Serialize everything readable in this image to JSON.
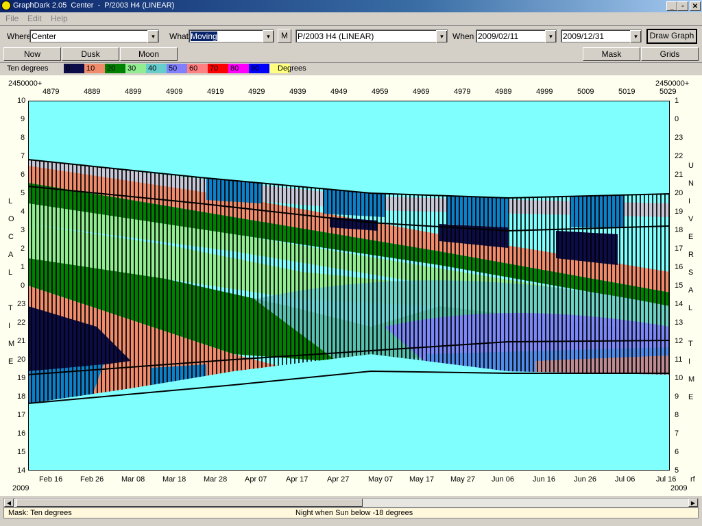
{
  "titlebar": {
    "title": "GraphDark 2.05  Center  -  P/2003 H4 (LINEAR)",
    "min": "_",
    "restore": "▫",
    "close": "✕"
  },
  "menu": [
    "File",
    "Edit",
    "Help"
  ],
  "toolbar": {
    "where_label": "Where",
    "where_value": "Center",
    "what_label": "What",
    "what_value": "Moving",
    "m_button": "M",
    "object_value": "P/2003 H4 (LINEAR)",
    "when_label": "When",
    "when_start": "2009/02/11",
    "when_end": "2009/12/31",
    "draw_button": "Draw Graph"
  },
  "buttons": {
    "now": "Now",
    "dusk": "Dusk",
    "moon": "Moon",
    "mask": "Mask",
    "grids": "Grids"
  },
  "legend": {
    "title": "Ten degrees",
    "unit": "Degrees",
    "items": [
      {
        "label": "0",
        "color": "#0c0c48"
      },
      {
        "label": "10",
        "color": "#f08c6c"
      },
      {
        "label": "20",
        "color": "#008000"
      },
      {
        "label": "30",
        "color": "#90ee90"
      },
      {
        "label": "40",
        "color": "#66cccc"
      },
      {
        "label": "50",
        "color": "#8080ff"
      },
      {
        "label": "60",
        "color": "#ff8080"
      },
      {
        "label": "70",
        "color": "#ff0000"
      },
      {
        "label": "80",
        "color": "#ff00ff"
      },
      {
        "label": "90",
        "color": "#0000ff"
      },
      {
        "label": "",
        "color": "#ffff80"
      }
    ]
  },
  "chart": {
    "jd_prefix_left": "2450000+",
    "jd_prefix_right": "2450000+",
    "jd_ticks": [
      "4879",
      "4889",
      "4899",
      "4909",
      "4919",
      "4929",
      "4939",
      "4949",
      "4959",
      "4969",
      "4979",
      "4989",
      "4999",
      "5009",
      "5019",
      "5029"
    ],
    "date_ticks": [
      "Feb 16",
      "Feb 26",
      "Mar 08",
      "Mar 18",
      "Mar 28",
      "Apr 07",
      "Apr 17",
      "Apr 27",
      "May 07",
      "May 17",
      "May 27",
      "Jun 06",
      "Jun 16",
      "Jun 26",
      "Jul 06",
      "Jul 16"
    ],
    "year_left": "2009",
    "year_right": "2009",
    "right_suffix": "rf",
    "local_time_ticks": [
      "10",
      "9",
      "8",
      "7",
      "6",
      "5",
      "4",
      "3",
      "2",
      "1",
      "0",
      "23",
      "22",
      "21",
      "20",
      "19",
      "18",
      "17",
      "16",
      "15",
      "14"
    ],
    "universal_time_ticks": [
      "1",
      "0",
      "23",
      "22",
      "21",
      "20",
      "19",
      "18",
      "17",
      "16",
      "15",
      "14",
      "13",
      "12",
      "11",
      "10",
      "9",
      "8",
      "7",
      "6",
      "5"
    ],
    "left_axis_letters": [
      "L",
      "O",
      "C",
      "A",
      "L",
      "",
      "T",
      "I",
      "M",
      "E"
    ],
    "right_axis_letters": [
      "U",
      "N",
      "I",
      "V",
      "E",
      "R",
      "S",
      "A",
      "L",
      "",
      "T",
      "I",
      "M",
      "E"
    ],
    "background_color": "#80ffff"
  },
  "status": {
    "left": "Mask:  Ten degrees",
    "center": "Night when Sun below -18 degrees"
  }
}
